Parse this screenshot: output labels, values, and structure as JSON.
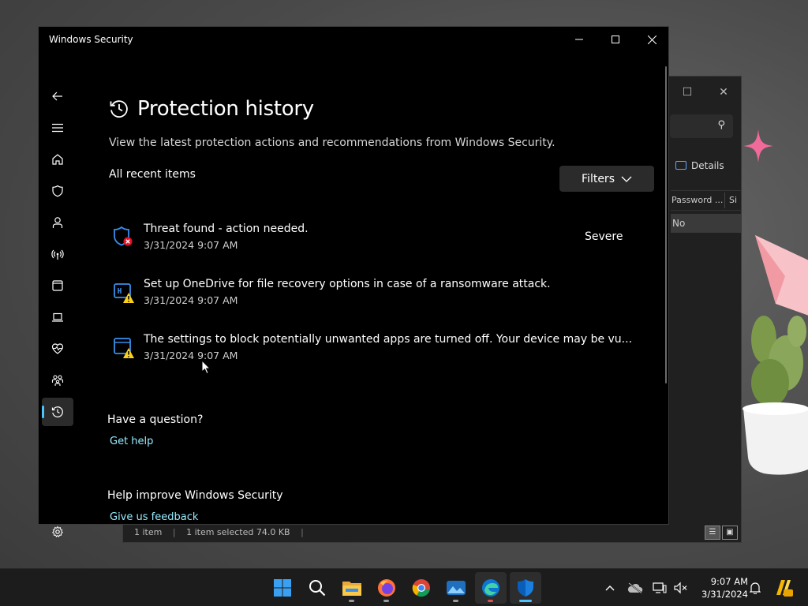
{
  "window": {
    "title": "Windows Security",
    "minimize_icon": "minimize-icon",
    "maximize_icon": "maximize-icon",
    "close_icon": "close-icon"
  },
  "nav": {
    "items": [
      {
        "name": "back",
        "icon": "back-arrow-icon"
      },
      {
        "name": "menu",
        "icon": "hamburger-icon"
      },
      {
        "name": "home",
        "icon": "home-icon"
      },
      {
        "name": "virus-protection",
        "icon": "shield-icon"
      },
      {
        "name": "account-protection",
        "icon": "person-icon"
      },
      {
        "name": "firewall",
        "icon": "wifi-antenna-icon"
      },
      {
        "name": "app-browser-control",
        "icon": "browser-window-icon"
      },
      {
        "name": "device-security",
        "icon": "laptop-icon"
      },
      {
        "name": "device-performance",
        "icon": "heart-pulse-icon"
      },
      {
        "name": "family-options",
        "icon": "family-icon"
      },
      {
        "name": "protection-history",
        "icon": "history-icon",
        "active": true
      },
      {
        "name": "settings",
        "icon": "gear-icon"
      }
    ]
  },
  "page": {
    "title": "Protection history",
    "subtitle": "View the latest protection actions and recommendations from Windows Security.",
    "section_label": "All recent items",
    "filters_label": "Filters"
  },
  "items": [
    {
      "text": "Threat found - action needed.",
      "date": "3/31/2024 9:07 AM",
      "severity": "Severe",
      "icon": "shield-error-icon"
    },
    {
      "text": "Set up OneDrive for file recovery options in case of a ransomware attack.",
      "date": "3/31/2024 9:07 AM",
      "severity": "",
      "icon": "ransomware-warning-icon"
    },
    {
      "text": "The settings to block potentially unwanted apps are turned off. Your device may be vu...",
      "date": "3/31/2024 9:07 AM",
      "severity": "",
      "icon": "app-browser-warning-icon"
    }
  ],
  "help": {
    "question_heading": "Have a question?",
    "get_help_link": "Get help",
    "improve_heading": "Help improve Windows Security",
    "feedback_link": "Give us feedback"
  },
  "explorer": {
    "details_label": "Details",
    "column_name": "Password ...",
    "column_next": "Si",
    "row_value": "No",
    "status_items": "1 item",
    "status_selected": "1 item selected  74.0 KB",
    "separator": "|"
  },
  "taskbar": {
    "apps": [
      {
        "name": "start",
        "icon": "windows-start-icon"
      },
      {
        "name": "search",
        "icon": "search-icon"
      },
      {
        "name": "file-explorer",
        "icon": "folder-icon"
      },
      {
        "name": "firefox",
        "icon": "firefox-icon"
      },
      {
        "name": "chrome",
        "icon": "chrome-icon"
      },
      {
        "name": "photos",
        "icon": "photos-icon"
      },
      {
        "name": "edge",
        "icon": "edge-icon"
      },
      {
        "name": "windows-security",
        "icon": "shield-icon",
        "active": true
      }
    ],
    "time": "9:07 AM",
    "date": "3/31/2024"
  },
  "colors": {
    "accent": "#4cc2ff",
    "link": "#99ebff",
    "error": "#e81123",
    "warning": "#fcd116"
  }
}
